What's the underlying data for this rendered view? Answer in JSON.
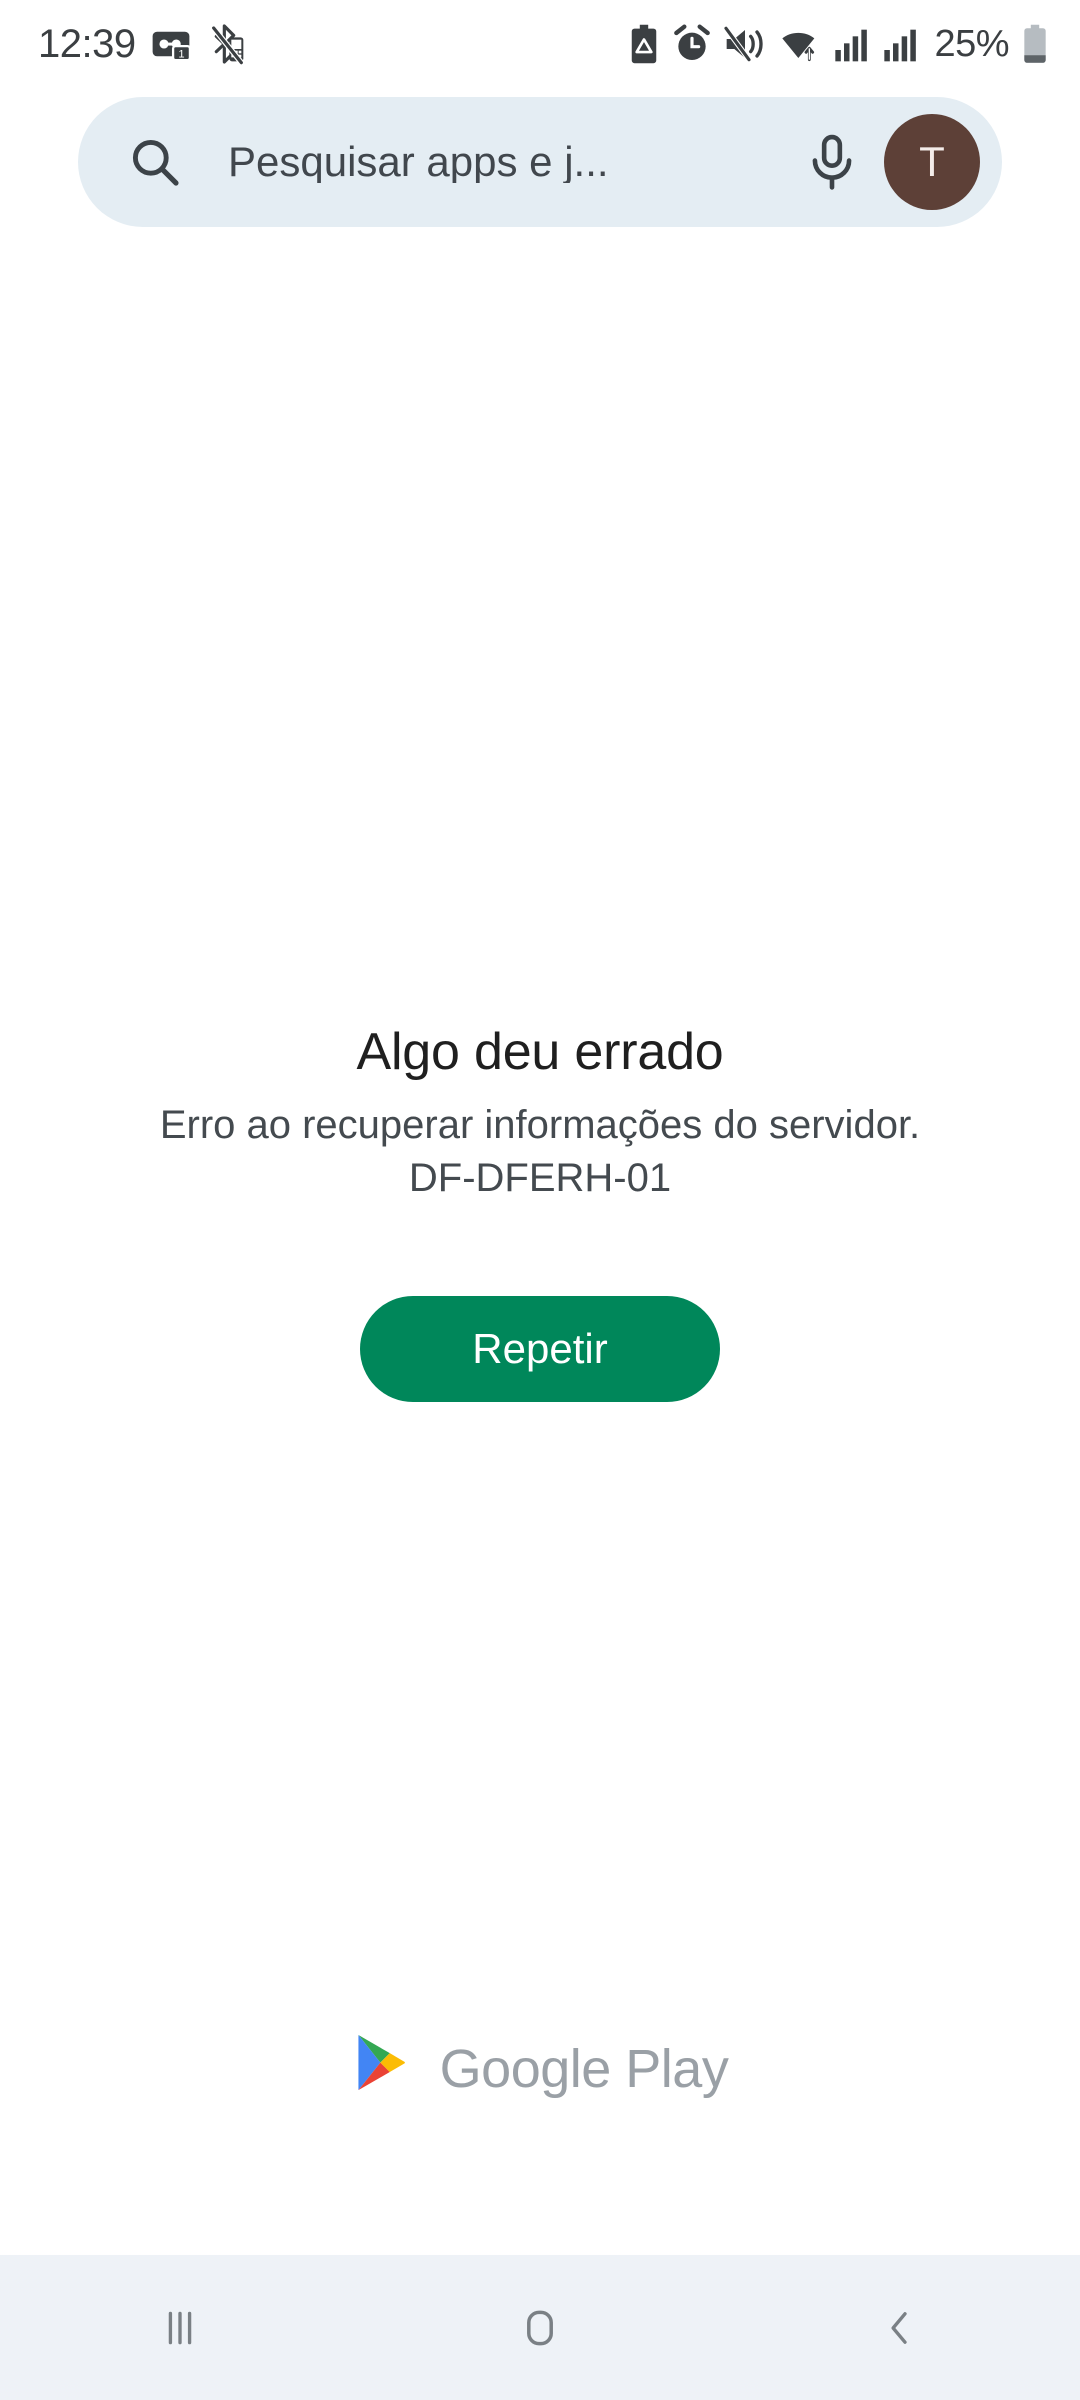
{
  "status_bar": {
    "time": "12:39",
    "battery_percent": "25%",
    "left_icons": [
      "voicemail-sim-icon",
      "bluetooth-off-icon"
    ],
    "right_icons": [
      "battery-saver-icon",
      "alarm-icon",
      "vibrate-mute-icon",
      "wifi-icon",
      "signal-sim1-icon",
      "signal-sim2-icon",
      "battery-icon"
    ],
    "text_color": "#3b3f42"
  },
  "search": {
    "placeholder": "Pesquisar apps e j...",
    "search_icon": "search-icon",
    "mic_icon": "microphone-icon",
    "avatar_initial": "T",
    "avatar_color": "#5d4037",
    "background": "#e4edf3"
  },
  "error": {
    "title": "Algo deu errado",
    "description": "Erro ao recuperar informações do servidor.",
    "code": "DF-DFERH-01",
    "retry_label": "Repetir",
    "retry_color": "#00875a"
  },
  "branding": {
    "wordmark": "Google Play",
    "logo_icon": "google-play-triangle-icon",
    "wordmark_color": "#9aa0a6",
    "logo_colors": {
      "green": "#34a853",
      "blue": "#4285f4",
      "yellow": "#fbbc04",
      "red": "#ea4335"
    }
  },
  "nav_bar": {
    "background": "#eef2f7",
    "icon_color": "#7a8085",
    "buttons": [
      {
        "name": "recents-button",
        "icon": "recents-icon"
      },
      {
        "name": "home-button",
        "icon": "home-icon"
      },
      {
        "name": "back-button",
        "icon": "back-chevron-icon"
      }
    ]
  }
}
